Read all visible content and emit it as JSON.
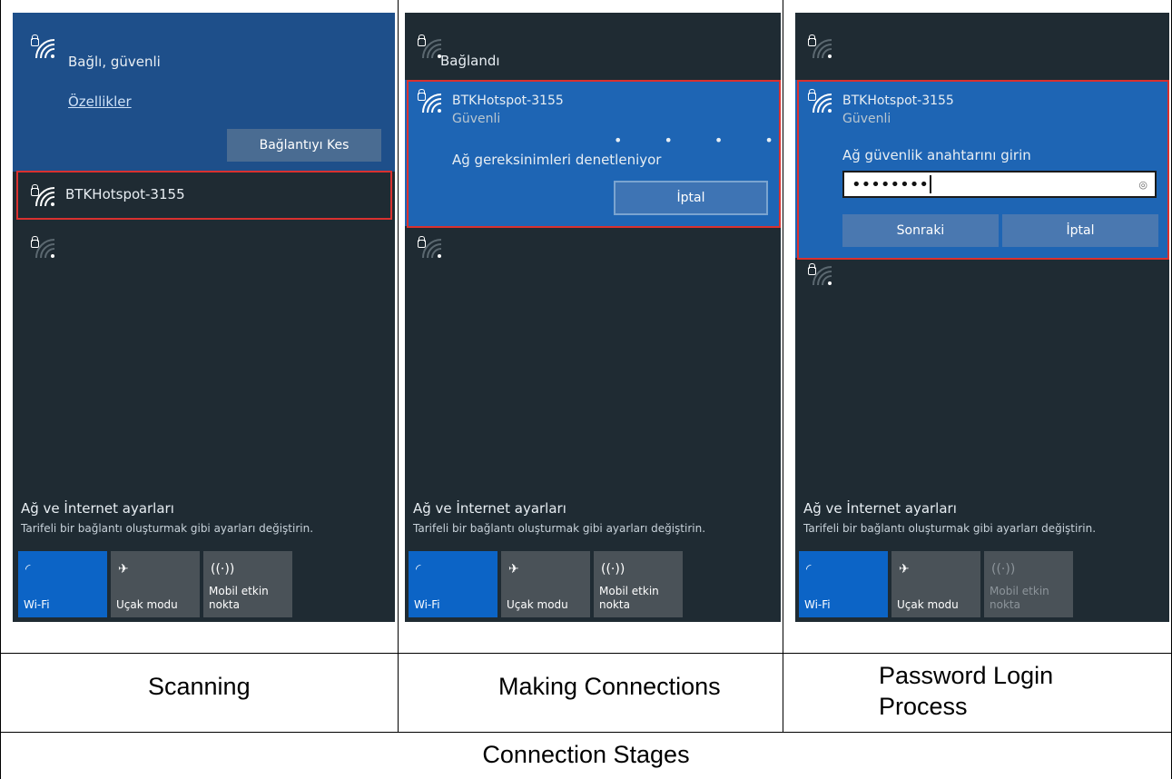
{
  "panels": [
    {
      "status": "Bağlı, güvenli",
      "properties_link": "Özellikler",
      "disconnect_button": "Bağlantıyı Kes",
      "network_name": "BTKHotspot-3155"
    },
    {
      "status": "Bağlandı",
      "network_name": "BTKHotspot-3155",
      "security": "Güvenli",
      "progress_text": "Ağ gereksinimleri denetleniyor",
      "cancel_button": "İptal"
    },
    {
      "network_name": "BTKHotspot-3155",
      "security": "Güvenli",
      "prompt": "Ağ güvenlik anahtarını girin",
      "password_value": "••••••••",
      "next_button": "Sonraki",
      "cancel_button": "İptal"
    }
  ],
  "settings": {
    "title": "Ağ ve İnternet ayarları",
    "subtitle": "Tarifeli bir bağlantı oluşturmak gibi ayarları değiştirin."
  },
  "tiles": {
    "wifi": "Wi-Fi",
    "airplane": "Uçak modu",
    "hotspot_line1": "Mobil etkin",
    "hotspot_line2": "nokta"
  },
  "captions": {
    "col1": "Scanning",
    "col2": "Making Connections",
    "col3_line1": "Password Login",
    "col3_line2": "Process",
    "footer": "Connection Stages"
  },
  "colors": {
    "panel_bg": "#1f2b33",
    "highlight_blue": "#1e4f8a",
    "selection_red": "#d9312f",
    "tile_blue": "#0c64c6"
  }
}
